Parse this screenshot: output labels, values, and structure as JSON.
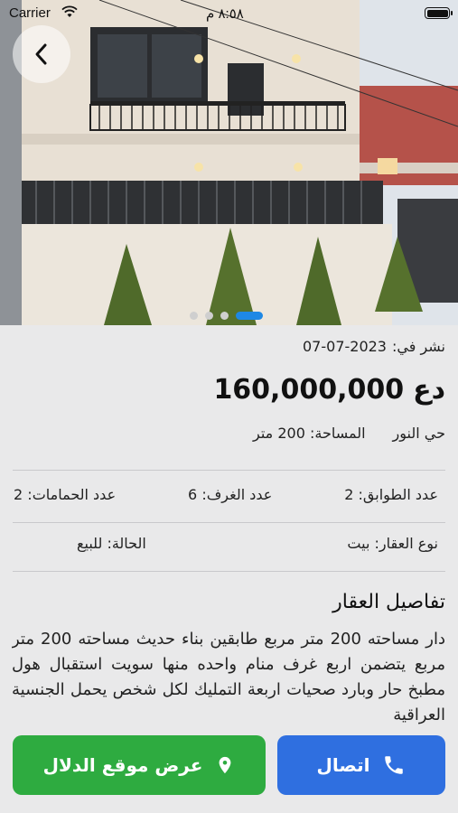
{
  "status_bar": {
    "carrier": "Carrier",
    "time": "٨:٥٨ م"
  },
  "gallery": {
    "image_count": 4,
    "active_index": 3
  },
  "listing": {
    "published_label": "نشر في:",
    "published_date": "07-07-2023",
    "price_value": "160,000,000",
    "price_currency": "دع",
    "neighborhood": "حي النور",
    "area_label": "المساحة:",
    "area_value": "200 متر",
    "floors_label": "عدد الطوابق:",
    "floors_value": "2",
    "rooms_label": "عدد الغرف:",
    "rooms_value": "6",
    "baths_label": "عدد الحمامات:",
    "baths_value": "2",
    "type_label": "نوع العقار:",
    "type_value": "بيت",
    "status_label": "الحالة:",
    "status_value": "للبيع",
    "details_title": "تفاصيل العقار",
    "description": "دار مساحته 200 متر مربع طابقين بناء حديث مساحته 200 متر مربع يتضمن اربع غرف منام واحده منها سويت استقبال هول مطبخ حار وبارد صحيات اربعة التمليك لكل شخص يحمل الجنسية العراقية"
  },
  "actions": {
    "call_label": "اتصال",
    "location_label": "عرض موقع الدلال"
  },
  "colors": {
    "call": "#2f6fe0",
    "location": "#2eab40",
    "dot_active": "#1e88e5"
  }
}
